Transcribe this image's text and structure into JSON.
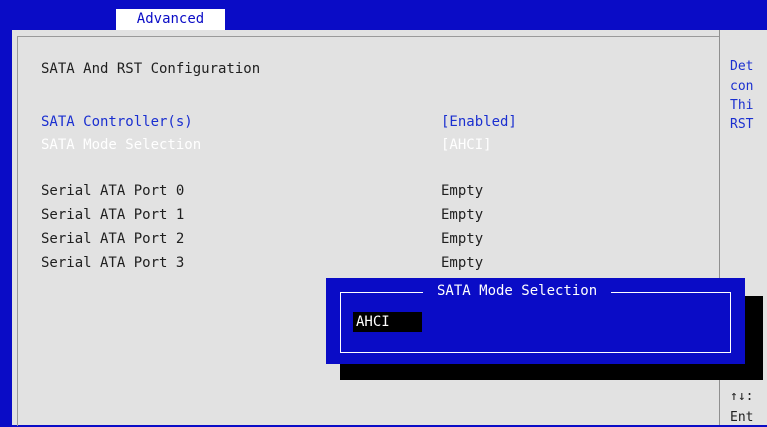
{
  "tabs": {
    "active": "Advanced"
  },
  "section": {
    "title": "SATA And RST Configuration"
  },
  "settings": [
    {
      "label": "SATA Controller(s)",
      "value": "[Enabled]"
    },
    {
      "label": "SATA Mode Selection",
      "value": "[AHCI]"
    }
  ],
  "ports": [
    {
      "label": "Serial ATA Port 0",
      "value": "Empty"
    },
    {
      "label": "Serial ATA Port 1",
      "value": "Empty"
    },
    {
      "label": "Serial ATA Port 2",
      "value": "Empty"
    },
    {
      "label": "Serial ATA Port 3",
      "value": "Empty"
    }
  ],
  "help_text": {
    "lines": [
      "Det",
      "con",
      "Thi",
      "RST"
    ],
    "bottom_lines": [
      "↑↓:",
      "Ent"
    ]
  },
  "popup": {
    "title": "SATA Mode Selection",
    "options": [
      "AHCI"
    ],
    "selected": "AHCI"
  },
  "colors": {
    "bios_blue": "#0a0cc6",
    "panel_gray": "#e2e2e2",
    "selectable_text": "#1a2fd0",
    "highlight_text": "#ffffff"
  }
}
